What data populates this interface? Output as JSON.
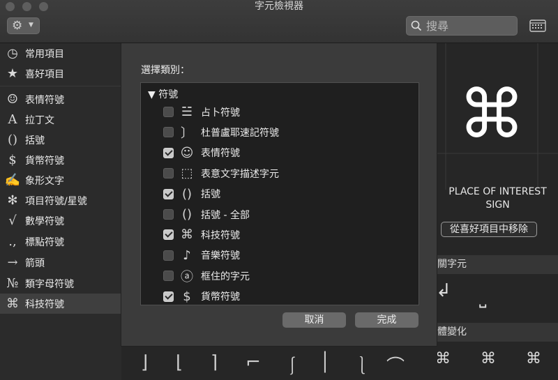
{
  "window": {
    "title": "字元檢視器"
  },
  "toolbar": {
    "gear_icon": "gear-icon",
    "search_placeholder": "搜尋"
  },
  "sidebar": {
    "items": [
      {
        "icon": "◷",
        "label": "常用項目"
      },
      {
        "icon": "★",
        "label": "喜好項目"
      },
      {
        "icon": "☺",
        "label": "表情符號"
      },
      {
        "icon": "A",
        "label": "拉丁文"
      },
      {
        "icon": "()",
        "label": "括號"
      },
      {
        "icon": "$",
        "label": "貨幣符號"
      },
      {
        "icon": "✍",
        "label": "象形文字"
      },
      {
        "icon": "✻",
        "label": "項目符號/星號"
      },
      {
        "icon": "√",
        "label": "數學符號"
      },
      {
        "icon": ".,",
        "label": "標點符號"
      },
      {
        "icon": "→",
        "label": "箭頭"
      },
      {
        "icon": "№",
        "label": "類字母符號"
      },
      {
        "icon": "⌘",
        "label": "科技符號"
      }
    ]
  },
  "sheet": {
    "label": "選擇類別：",
    "group": "▼ 符號",
    "rows": [
      {
        "icon": "☱",
        "label": "占卜符號",
        "checked": false
      },
      {
        "icon": "〕",
        "label": "杜普盧耶速記符號",
        "checked": false
      },
      {
        "icon": "☺",
        "label": "表情符號",
        "checked": true
      },
      {
        "icon": "⬚",
        "label": "表意文字描述字元",
        "checked": false
      },
      {
        "icon": "()",
        "label": "括號",
        "checked": true
      },
      {
        "icon": "()",
        "label": "括號 - 全部",
        "checked": false
      },
      {
        "icon": "⌘",
        "label": "科技符號",
        "checked": true
      },
      {
        "icon": "♪",
        "label": "音樂符號",
        "checked": false
      },
      {
        "icon": "ⓐ",
        "label": "框住的字元",
        "checked": false
      },
      {
        "icon": "$",
        "label": "貨幣符號",
        "checked": true
      }
    ],
    "cancel": "取消",
    "done": "完成"
  },
  "detail": {
    "glyph": "⌘",
    "name": "PLACE OF INTEREST SIGN",
    "remove_favorite": "從喜好項目中移除",
    "related_header": "關字元",
    "variants_header": "體變化",
    "related_glyphs": [
      "↲",
      "⎵"
    ],
    "variant_glyphs": [
      "⌘",
      "⌘",
      "⌘"
    ]
  },
  "bottom_strip": {
    "glyphs": [
      "⌋",
      "⌊",
      "⌉",
      "⌐",
      "⎰",
      "│",
      "⎱",
      "⌒"
    ]
  }
}
